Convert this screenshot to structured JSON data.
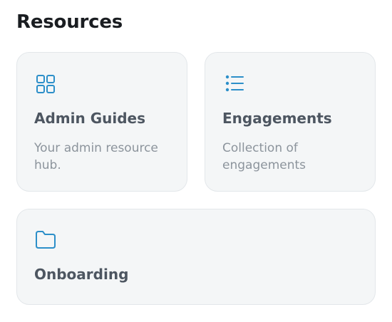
{
  "section": {
    "title": "Resources"
  },
  "cards": [
    {
      "title": "Admin Guides",
      "description": "Your admin resource hub.",
      "icon": "grid-icon"
    },
    {
      "title": "Engagements",
      "description": "Collection of engagements",
      "icon": "list-icon"
    },
    {
      "title": "Onboarding",
      "icon": "folder-icon"
    }
  ],
  "colors": {
    "icon_accent": "#2c8fc9",
    "card_background": "#f4f6f7",
    "card_border": "#e3e7ea",
    "title_text": "#4d5661",
    "description_text": "#8c949c",
    "heading_text": "#1a1d21"
  }
}
